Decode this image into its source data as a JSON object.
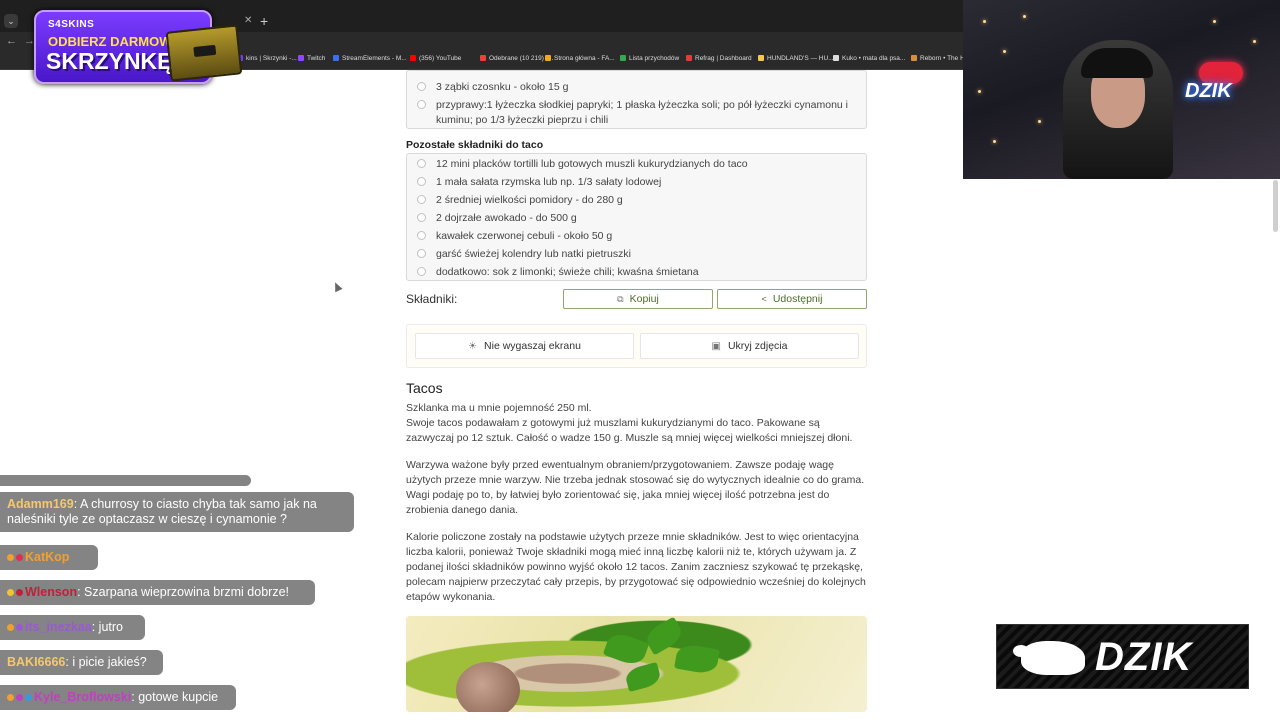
{
  "browser": {
    "bookmarks": [
      {
        "label": "kins | Skrzynki -...",
        "color": "#6b3cff"
      },
      {
        "label": "Twitch",
        "color": "#9146ff"
      },
      {
        "label": "StreamElements - M...",
        "color": "#3d6df2"
      },
      {
        "label": "(356) YouTube",
        "color": "#ff0000"
      },
      {
        "label": "Odebrane (10 219) -...",
        "color": "#ea4335"
      },
      {
        "label": "Strona główna - FA...",
        "color": "#f5a623"
      },
      {
        "label": "Lista przychodów",
        "color": "#34a853"
      },
      {
        "label": "Refrag | Dashboard",
        "color": "#e23b3b"
      },
      {
        "label": "HUNDLAND'S — HU...",
        "color": "#f2c94c"
      },
      {
        "label": "Kuko • mata dla psa...",
        "color": "#dddddd"
      },
      {
        "label": "Reborn • The Ho...",
        "color": "#d98c3a"
      }
    ]
  },
  "promo": {
    "logo": "S4SKINS",
    "line1": "ODBIERZ DARMOWĄ",
    "line2": "SKRZYNKĘ!"
  },
  "recipe": {
    "ingredients_top": [
      "3 ząbki czosnku - około 15 g",
      "przyprawy:1 łyżeczka słodkiej papryki; 1 płaska łyżeczka soli; po pół łyżeczki cynamonu i kuminu; po 1/3 łyżeczki pieprzu i chili"
    ],
    "section_title": "Pozostałe składniki do taco",
    "ingredients_taco": [
      "12 mini placków tortilli lub gotowych muszli kukurydzianych do taco",
      "1 mała sałata rzymska lub np. 1/3 sałaty lodowej",
      "2 średniej wielkości pomidory - do 280 g",
      "2 dojrzałe awokado - do 500 g",
      "kawałek czerwonej cebuli - około 50 g",
      "garść świeżej kolendry lub natki pietruszki",
      "dodatkowo: sok z limonki; świeże chili; kwaśna śmietana"
    ],
    "skladniki_label": "Składniki:",
    "copy_label": "Kopiuj",
    "share_label": "Udostępnij",
    "screen_label": "Nie wygaszaj ekranu",
    "photos_label": "Ukryj zdjęcia",
    "heading": "Tacos",
    "paragraphs": [
      "Szklanka ma u mnie pojemność 250 ml.\nSwoje tacos podawałam z gotowymi już muszlami kukurydzianymi do taco. Pakowane są zazwyczaj po 12 sztuk. Całość o wadze 150 g. Muszle są mniej więcej wielkości mniejszej dłoni.",
      "Warzywa ważone były przed ewentualnym obraniem/przygotowaniem. Zawsze podaję wagę użytych przeze mnie warzyw. Nie trzeba jednak stosować się do wytycznych idealnie co do grama. Wagi podaję po to, by łatwiej było zorientować się, jaka mniej więcej ilość potrzebna jest do zrobienia danego dania.",
      "Kalorie policzone zostały na podstawie użytych przeze mnie składników. Jest to więc orientacyjna liczba kalorii, ponieważ Twoje składniki mogą mieć inną liczbę kalorii niż te, których używam ja. Z podanej ilości składników powinno wyjść około 12 tacos. Zanim zaczniesz szykować tę przekąskę, polecam najpierw przeczytać cały przepis, by przygotować się odpowiednio wcześniej do kolejnych etapów wykonania."
    ]
  },
  "webcam": {
    "neon_text": "DZIK"
  },
  "chat": [
    {
      "user": "Adamm169",
      "color": "#f5c96b",
      "text": "A churrosy to ciasto chyba tak samo jak na naleśniki tyle ze optaczasz w cieszę i cynamonie ?"
    },
    {
      "user": "KatKop",
      "color": "#f0a030",
      "text": ""
    },
    {
      "user": "Wlenson",
      "color": "#c0203a",
      "text": "Szarpana wieprzowina brzmi dobrze!"
    },
    {
      "user": "its_inezkaa",
      "color": "#9b59d0",
      "text": "jutro"
    },
    {
      "user": "BAKI6666",
      "color": "#f5c96b",
      "text": "i picie jakieś?"
    },
    {
      "user": "Kyle_Broflowski",
      "color": "#c040c0",
      "text": "gotowe kupcie"
    }
  ],
  "sponsor": {
    "text": "DZIK"
  }
}
